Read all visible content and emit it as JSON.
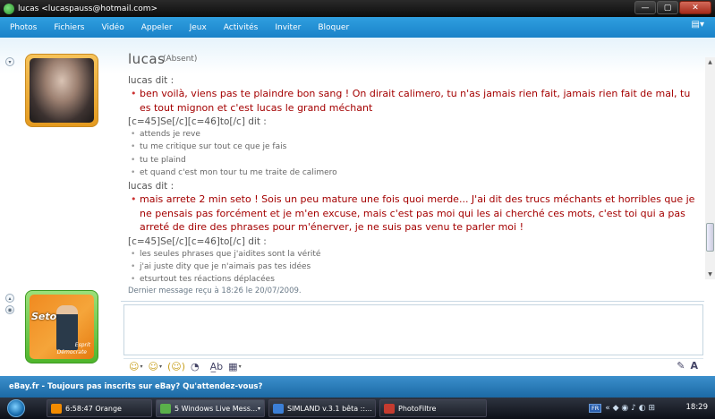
{
  "window": {
    "title": "lucas <lucaspauss@hotmail.com>",
    "buttons": {
      "minimize": "—",
      "maximize": "▢",
      "close": "✕"
    }
  },
  "menu": {
    "items": [
      "Photos",
      "Fichiers",
      "Vidéo",
      "Appeler",
      "Jeux",
      "Activités",
      "Inviter",
      "Bloquer"
    ],
    "options_icon": "settings-dropdown-icon",
    "options_glyph": "▤▾"
  },
  "contact": {
    "name": "lucas",
    "status": "(Absent)"
  },
  "conversation": [
    {
      "sender": "lucas dit :",
      "style": "big",
      "lines": [
        "ben voilà, viens pas te plaindre bon sang ! On dirait calimero, tu n'as jamais rien fait, jamais rien fait de mal, tu es tout mignon et c'est lucas le grand méchant"
      ]
    },
    {
      "sender": "[c=45]Se[/c][c=46]to[/c] dit :",
      "style": "small",
      "lines": [
        "attends je reve",
        "tu me critique sur tout ce que je fais",
        "tu te plaind",
        "et quand c'est mon tour tu me traite de calimero"
      ]
    },
    {
      "sender": "lucas dit :",
      "style": "big",
      "lines": [
        "mais arrete 2 min seto ! Sois un peu mature une fois quoi merde... J'ai dit des trucs méchants et horribles que je ne pensais pas forcément et je m'en excuse, mais c'est pas moi qui les ai cherché ces mots, c'est toi qui a pas arreté de dire des phrases pour m'énerver, je ne suis pas venu te parler moi !"
      ]
    },
    {
      "sender": "[c=45]Se[/c][c=46]to[/c] dit :",
      "style": "small",
      "lines": [
        "les seules phrases que j'aidites sont la vérité",
        "j'ai juste dity que je n'aimais pas tes idées",
        "etsurtout tes réactions déplacées"
      ]
    }
  ],
  "last_message": "Dernier message reçu à 18:26 le 20/07/2009.",
  "my_avatar": {
    "text_main": "Seto",
    "text_line1": "Esprit",
    "text_line2": "Démocrate"
  },
  "compose": {
    "value": "",
    "toolbar": {
      "emoticon_glyph": "☺",
      "wink_glyph": "☺",
      "nudge_glyph": "(☺)",
      "voice_clip_glyph": "◔",
      "font_glyph": "A̲b",
      "background_glyph": "▦",
      "handwriting_glyph": "✎",
      "text_glyph": "A"
    }
  },
  "ad": {
    "text": "eBay.fr - Toujours pas inscrits sur eBay? Qu'attendez-vous?"
  },
  "taskbar": {
    "tasks": [
      {
        "label": "6:58:47 Orange"
      },
      {
        "label": "5 Windows Live Mess..."
      },
      {
        "label": "SIMLAND v.3.1 bêta ::..."
      },
      {
        "label": "PhotoFiltre"
      }
    ],
    "tray": {
      "lang": "FR",
      "icons_glyph": "« ◆ ◉ ♪ ◐ ⊞"
    },
    "clock": "18:29"
  },
  "colors": {
    "menu_bar": "#1a82c8",
    "contact_message": "#a40000",
    "own_message": "#666666",
    "ad_bar": "#1c6aa5"
  }
}
